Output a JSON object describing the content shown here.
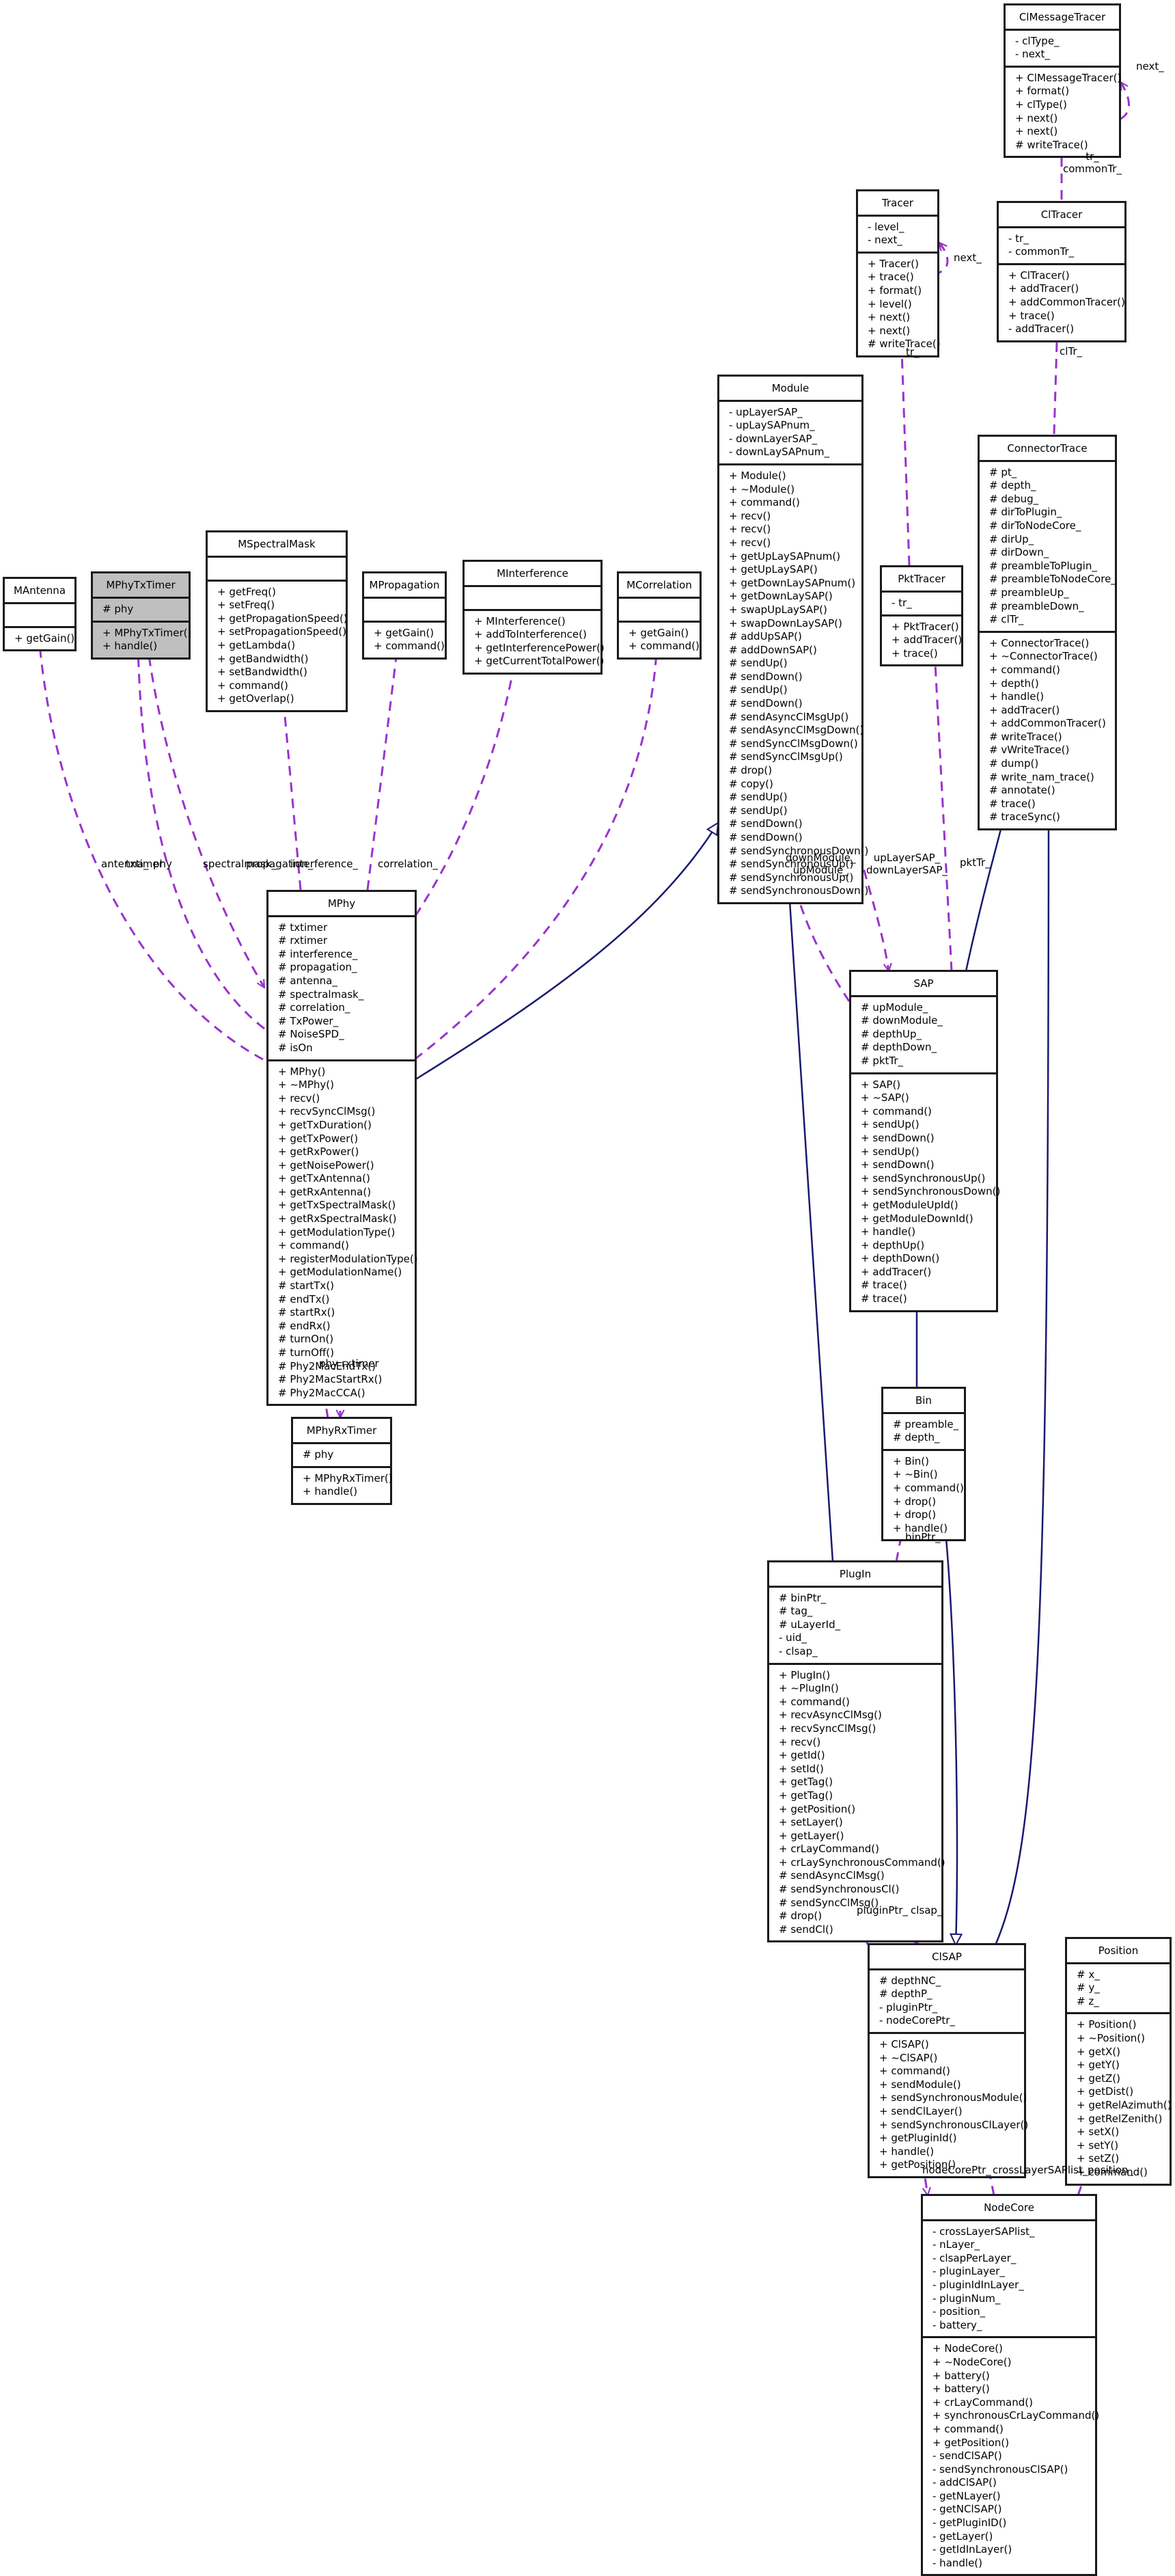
{
  "diagram": {
    "type": "uml-class-collaboration",
    "colors": {
      "association": "#9a32cd",
      "inheritance": "#191970",
      "border": "#1a1a1a",
      "focus_fill": "#bfbfbf"
    }
  },
  "classes": {
    "CIMessageTracer": {
      "name": "ClMessageTracer",
      "attrs": [
        "- clType_",
        "- next_"
      ],
      "methods": [
        "+ ClMessageTracer()",
        "+ format()",
        "+ clType()",
        "+ next()",
        "+ next()",
        "# writeTrace()"
      ]
    },
    "Tracer": {
      "name": "Tracer",
      "attrs": [
        "- level_",
        "- next_"
      ],
      "methods": [
        "+ Tracer()",
        "+ trace()",
        "+ format()",
        "+ level()",
        "+ next()",
        "+ next()",
        "# writeTrace()"
      ]
    },
    "CITracer": {
      "name": "ClTracer",
      "attrs": [
        "- tr_",
        "- commonTr_"
      ],
      "methods": [
        "+ ClTracer()",
        "+ addTracer()",
        "+ addCommonTracer()",
        "+ trace()",
        "- addTracer()"
      ]
    },
    "ConnectorTrace": {
      "name": "ConnectorTrace",
      "attrs": [
        "# pt_",
        "# depth_",
        "# debug_",
        "# dirToPlugin_",
        "# dirToNodeCore_",
        "# dirUp_",
        "# dirDown_",
        "# preambleToPlugin_",
        "# preambleToNodeCore_",
        "# preambleUp_",
        "# preambleDown_",
        "# clTr_"
      ],
      "methods": [
        "+ ConnectorTrace()",
        "+ ~ConnectorTrace()",
        "+ command()",
        "+ depth()",
        "+ handle()",
        "+ addTracer()",
        "+ addCommonTracer()",
        "# writeTrace()",
        "# vWriteTrace()",
        "# dump()",
        "# write_nam_trace()",
        "# annotate()",
        "# trace()",
        "# traceSync()"
      ]
    },
    "Module": {
      "name": "Module",
      "attrs": [
        "- upLayerSAP_",
        "- upLaySAPnum_",
        "- downLayerSAP_",
        "- downLaySAPnum_"
      ],
      "methods": [
        "+ Module()",
        "+ ~Module()",
        "+ command()",
        "+ recv()",
        "+ recv()",
        "+ recv()",
        "+ getUpLaySAPnum()",
        "+ getUpLaySAP()",
        "+ getDownLaySAPnum()",
        "+ getDownLaySAP()",
        "+ swapUpLaySAP()",
        "+ swapDownLaySAP()",
        "# addUpSAP()",
        "# addDownSAP()",
        "# sendUp()",
        "# sendDown()",
        "# sendUp()",
        "# sendDown()",
        "# sendAsyncClMsgUp()",
        "# sendAsyncClMsgDown()",
        "# sendSyncClMsgDown()",
        "# sendSyncClMsgUp()",
        "# drop()",
        "# copy()",
        "# sendUp()",
        "# sendUp()",
        "# sendDown()",
        "# sendDown()",
        "# sendSynchronousDown()",
        "# sendSynchronousUp()",
        "# sendSynchronousUp()",
        "# sendSynchronousDown()"
      ]
    },
    "PktTracer": {
      "name": "PktTracer",
      "attrs": [
        "- tr_"
      ],
      "methods": [
        "+ PktTracer()",
        "+ addTracer()",
        "+ trace()"
      ]
    },
    "MAntenna": {
      "name": "MAntenna",
      "attrs": [],
      "methods": [
        "+ getGain()"
      ]
    },
    "MPhyTxTimer": {
      "name": "MPhyTxTimer",
      "attrs": [
        "# phy"
      ],
      "methods": [
        "+ MPhyTxTimer()",
        "+ handle()"
      ]
    },
    "MSpectralMask": {
      "name": "MSpectralMask",
      "attrs": [],
      "methods": [
        "+ getFreq()",
        "+ setFreq()",
        "+ getPropagationSpeed()",
        "+ setPropagationSpeed()",
        "+ getLambda()",
        "+ getBandwidth()",
        "+ setBandwidth()",
        "+ command()",
        "+ getOverlap()"
      ]
    },
    "MPropagation": {
      "name": "MPropagation",
      "attrs": [],
      "methods": [
        "+ getGain()",
        "+ command()"
      ]
    },
    "MInterference": {
      "name": "MInterference",
      "attrs": [],
      "methods": [
        "+ MInterference()",
        "+ addToInterference()",
        "+ getInterferencePower()",
        "+ getCurrentTotalPower()"
      ]
    },
    "MCorrelation": {
      "name": "MCorrelation",
      "attrs": [],
      "methods": [
        "+ getGain()",
        "+ command()"
      ]
    },
    "MPhy": {
      "name": "MPhy",
      "attrs": [
        "# txtimer",
        "# rxtimer",
        "# interference_",
        "# propagation_",
        "# antenna_",
        "# spectralmask_",
        "# correlation_",
        "# TxPower_",
        "# NoiseSPD_",
        "# isOn"
      ],
      "methods": [
        "+ MPhy()",
        "+ ~MPhy()",
        "+ recv()",
        "+ recvSyncClMsg()",
        "+ getTxDuration()",
        "+ getTxPower()",
        "+ getRxPower()",
        "+ getNoisePower()",
        "+ getTxAntenna()",
        "+ getRxAntenna()",
        "+ getTxSpectralMask()",
        "+ getRxSpectralMask()",
        "+ getModulationType()",
        "+ command()",
        "+ registerModulationType()",
        "+ getModulationName()",
        "# startTx()",
        "# endTx()",
        "# startRx()",
        "# endRx()",
        "# turnOn()",
        "# turnOff()",
        "# Phy2MacEndTx()",
        "# Phy2MacStartRx()",
        "# Phy2MacCCA()"
      ]
    },
    "SAP": {
      "name": "SAP",
      "attrs": [
        "# upModule_",
        "# downModule_",
        "# depthUp_",
        "# depthDown_",
        "# pktTr_"
      ],
      "methods": [
        "+ SAP()",
        "+ ~SAP()",
        "+ command()",
        "+ sendUp()",
        "+ sendDown()",
        "+ sendUp()",
        "+ sendDown()",
        "+ sendSynchronousUp()",
        "+ sendSynchronousDown()",
        "+ getModuleUpId()",
        "+ getModuleDownId()",
        "+ handle()",
        "+ depthUp()",
        "+ depthDown()",
        "+ addTracer()",
        "# trace()",
        "# trace()"
      ]
    },
    "MPhyRxTimer": {
      "name": "MPhyRxTimer",
      "attrs": [
        "# phy"
      ],
      "methods": [
        "+ MPhyRxTimer()",
        "+ handle()"
      ]
    },
    "Bin": {
      "name": "Bin",
      "attrs": [
        "# preamble_",
        "# depth_"
      ],
      "methods": [
        "+ Bin()",
        "+ ~Bin()",
        "+ command()",
        "+ drop()",
        "+ drop()",
        "+ handle()"
      ]
    },
    "PlugIn": {
      "name": "PlugIn",
      "attrs": [
        "# binPtr_",
        "# tag_",
        "# uLayerId_",
        "- uid_",
        "- clsap_"
      ],
      "methods": [
        "+ PlugIn()",
        "+ ~PlugIn()",
        "+ command()",
        "+ recvAsyncClMsg()",
        "+ recvSyncClMsg()",
        "+ recv()",
        "+ getId()",
        "+ setId()",
        "+ getTag()",
        "+ getTag()",
        "+ getPosition()",
        "+ setLayer()",
        "+ getLayer()",
        "+ crLayCommand()",
        "+ crLaySynchronousCommand()",
        "# sendAsyncClMsg()",
        "# sendSynchronousCl()",
        "# sendSyncClMsg()",
        "# drop()",
        "# sendCl()"
      ]
    },
    "CISAP": {
      "name": "ClSAP",
      "attrs": [
        "# depthNC_",
        "# depthP_",
        "- pluginPtr_",
        "- nodeCorePtr_"
      ],
      "methods": [
        "+ ClSAP()",
        "+ ~ClSAP()",
        "+ command()",
        "+ sendModule()",
        "+ sendSynchronousModule()",
        "+ sendClLayer()",
        "+ sendSynchronousClLayer()",
        "+ getPluginId()",
        "+ handle()",
        "+ getPosition()"
      ]
    },
    "Position": {
      "name": "Position",
      "attrs": [
        "# x_",
        "# y_",
        "# z_"
      ],
      "methods": [
        "+ Position()",
        "+ ~Position()",
        "+ getX()",
        "+ getY()",
        "+ getZ()",
        "+ getDist()",
        "+ getRelAzimuth()",
        "+ getRelZenith()",
        "+ setX()",
        "+ setY()",
        "+ setZ()",
        "+ command()"
      ]
    },
    "NodeCore": {
      "name": "NodeCore",
      "attrs": [
        "- crossLayerSAPlist_",
        "- nLayer_",
        "- clsapPerLayer_",
        "- pluginLayer_",
        "- pluginIdInLayer_",
        "- pluginNum_",
        "- position_",
        "- battery_"
      ],
      "methods": [
        "+ NodeCore()",
        "+ ~NodeCore()",
        "+ battery()",
        "+ battery()",
        "+ crLayCommand()",
        "+ synchronousCrLayCommand()",
        "+ command()",
        "+ getPosition()",
        "- sendClSAP()",
        "- sendSynchronousClSAP()",
        "- addClSAP()",
        "- getNLayer()",
        "- getNClSAP()",
        "- getPluginID()",
        "- getLayer()",
        "- getIdInLayer()",
        "- handle()"
      ]
    }
  },
  "edge_labels": {
    "next_msg": "next_",
    "tr_common": "tr_\ncommonTr_",
    "next_tracer": "next_",
    "clTr": "clTr_",
    "tr_pkt": "tr_",
    "antenna": "antenna_",
    "txtimer": "txtimer",
    "phy_tx": "phy",
    "spectralmask": "spectralmask_",
    "propagation": "propagation_",
    "interference": "interference_",
    "correlation": "correlation_",
    "down_up_module": "downModule_\nupModule_",
    "up_down_layer_sap": "upLayerSAP_\ndownLayerSAP_",
    "pktTr": "pktTr_",
    "phy_rx": "phy",
    "rxtimer": "rxtimer",
    "binPtr": "binPtr_",
    "pluginPtr": "pluginPtr_",
    "clsap": "clsap_",
    "nodeCorePtr": "nodeCorePtr_",
    "crossLayerSAPlist": "crossLayerSAPlist_",
    "position": "position_"
  }
}
